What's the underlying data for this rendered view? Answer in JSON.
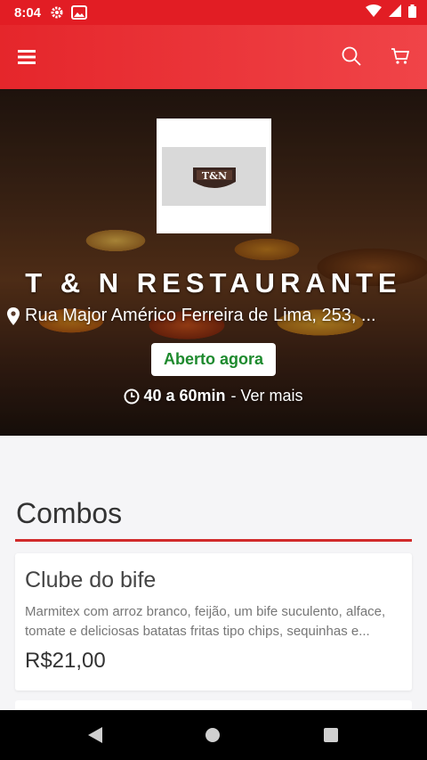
{
  "status_bar": {
    "time": "8:04"
  },
  "restaurant": {
    "logo_text": "T&N",
    "name": "T & N RESTAURANTE",
    "address": "Rua Major Américo Ferreira de Lima, 253, ...",
    "status": "Aberto agora",
    "delivery_time": "40 a 60min",
    "more_info": "- Ver mais"
  },
  "section": {
    "title": "Combos"
  },
  "products": [
    {
      "title": "Clube do bife",
      "description": "Marmitex com arroz branco, feijão, um bife suculento, alface, tomate e deliciosas batatas fritas tipo chips, sequinhas e...",
      "price": "R$21,00"
    }
  ],
  "colors": {
    "primary": "#e5262b",
    "open_green": "#1e8a2e",
    "accent_line": "#d12b2b"
  }
}
